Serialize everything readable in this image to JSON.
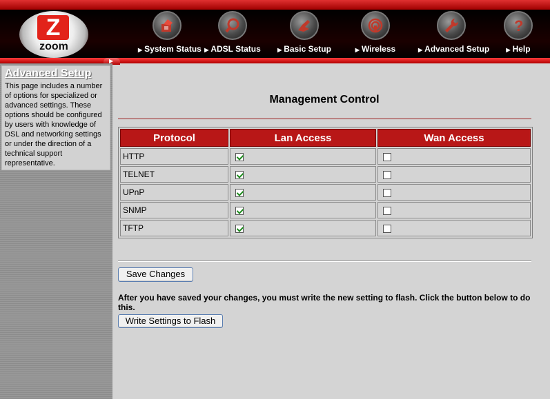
{
  "brand": {
    "logo_letter": "Z",
    "logo_text": "zoom"
  },
  "nav": [
    {
      "label": "System Status",
      "icon": "system-status-icon"
    },
    {
      "label": "ADSL Status",
      "icon": "magnifier-icon"
    },
    {
      "label": "Basic Setup",
      "icon": "hand-icon"
    },
    {
      "label": "Wireless",
      "icon": "wireless-icon"
    },
    {
      "label": "Advanced Setup",
      "icon": "wrench-icon"
    },
    {
      "label": "Help",
      "icon": "help-icon"
    }
  ],
  "sidebar": {
    "title": "Advanced Setup",
    "description": "This page includes a number of options for specialized or advanced settings. These options should be configured by users with knowledge of DSL and networking settings or under the direction of a technical support representative."
  },
  "main": {
    "title": "Management Control",
    "table": {
      "headers": [
        "Protocol",
        "Lan Access",
        "Wan Access"
      ],
      "rows": [
        {
          "protocol": "HTTP",
          "lan": true,
          "wan": false
        },
        {
          "protocol": "TELNET",
          "lan": true,
          "wan": false
        },
        {
          "protocol": "UPnP",
          "lan": true,
          "wan": false
        },
        {
          "protocol": "SNMP",
          "lan": true,
          "wan": false
        },
        {
          "protocol": "TFTP",
          "lan": true,
          "wan": false
        }
      ]
    },
    "save_label": "Save Changes",
    "note": "After you have saved your changes, you must write the new setting to flash. Click the button below to do this.",
    "flash_label": "Write Settings to Flash"
  },
  "colors": {
    "accent": "#b81717",
    "header_bg": "#000000",
    "page_bg": "#d4d4d4"
  }
}
